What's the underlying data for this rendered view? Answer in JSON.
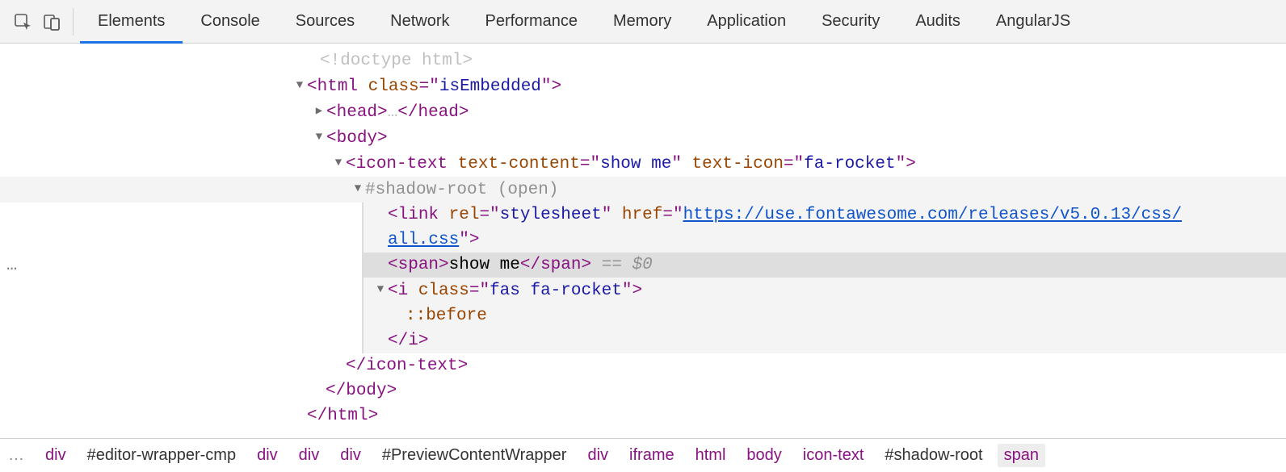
{
  "tabs": {
    "t0": "Elements",
    "t1": "Console",
    "t2": "Sources",
    "t3": "Network",
    "t4": "Performance",
    "t5": "Memory",
    "t6": "Application",
    "t7": "Security",
    "t8": "Audits",
    "t9": "AngularJS"
  },
  "dom": {
    "doctype": "<!doctype html>",
    "html_open_1": "<",
    "html_tag": "html",
    "html_attr_class_name": "class",
    "html_attr_class_val": "isEmbedded",
    "html_open_end": ">",
    "head_open": "<",
    "head_tag": "head",
    "head_close": ">",
    "head_ellipsis": "…",
    "head_endopen": "</",
    "body_open": "<",
    "body_tag": "body",
    "body_close_gt": ">",
    "icontext_tag": "icon-text",
    "icontext_attr1_name": "text-content",
    "icontext_attr1_val": "show me",
    "icontext_attr2_name": "text-icon",
    "icontext_attr2_val": "fa-rocket",
    "shadowroot": "#shadow-root (open)",
    "link_tag": "link",
    "link_rel_name": "rel",
    "link_rel_val": "stylesheet",
    "link_href_name": "href",
    "link_href_val_1": "https://use.fontawesome.com/releases/v5.0.13/css/",
    "link_href_val_2": "all.css",
    "span_tag": "span",
    "span_text": "show me",
    "eq_dollar": " == $0",
    "i_tag": "i",
    "i_class_name": "class",
    "i_class_val": "fas fa-rocket",
    "before_pseudo": "::before",
    "i_close": "</i>",
    "icontext_close": "</icon-text>",
    "body_close": "</body>",
    "html_close": "</html>"
  },
  "crumbs": {
    "lead": "…",
    "c0": "div",
    "c1": "#editor-wrapper-cmp",
    "c2": "div",
    "c3": "div",
    "c4": "div",
    "c5": "#PreviewContentWrapper",
    "c6": "div",
    "c7": "iframe",
    "c8": "html",
    "c9": "body",
    "c10": "icon-text",
    "c11": "#shadow-root",
    "c12": "span"
  }
}
